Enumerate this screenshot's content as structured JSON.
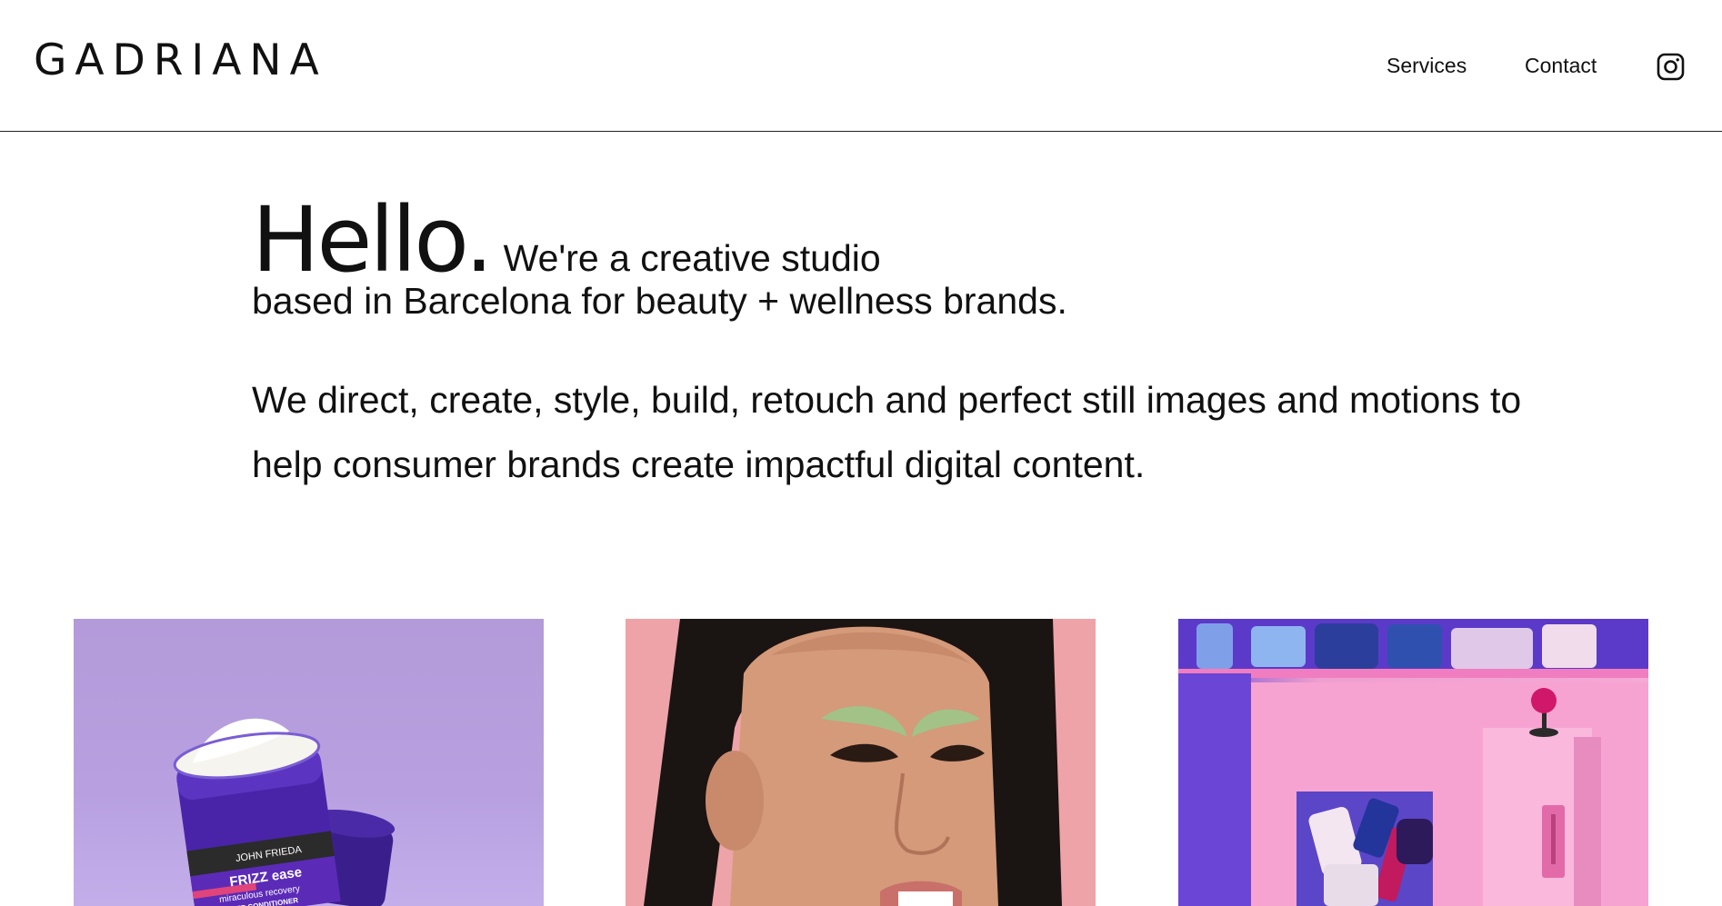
{
  "header": {
    "logo": "GADRIANA",
    "nav": {
      "services": "Services",
      "contact": "Contact"
    },
    "social_icon": "instagram-icon"
  },
  "intro": {
    "hello": "Hello.",
    "tagline_line1": "We're a creative studio",
    "tagline_line2": "based in Barcelona for beauty + wellness brands.",
    "description": "We direct, create, style, build, retouch and perfect still images and motions to help consumer brands create impactful digital content."
  },
  "gallery": {
    "items": [
      {
        "alt": "product-photo-jar",
        "background": "#b59de0",
        "jar_label": {
          "brand": "JOHN FRIEDA",
          "product": "FRIZZ ease",
          "line1": "miraculous recovery",
          "line2": "DEEP CONDITIONER"
        }
      },
      {
        "alt": "portrait-photo",
        "background": "#eea3a8"
      },
      {
        "alt": "installation-photo",
        "background": "#f5a9d5"
      }
    ]
  },
  "colors": {
    "text": "#111111",
    "border": "#222222",
    "background": "#ffffff"
  }
}
